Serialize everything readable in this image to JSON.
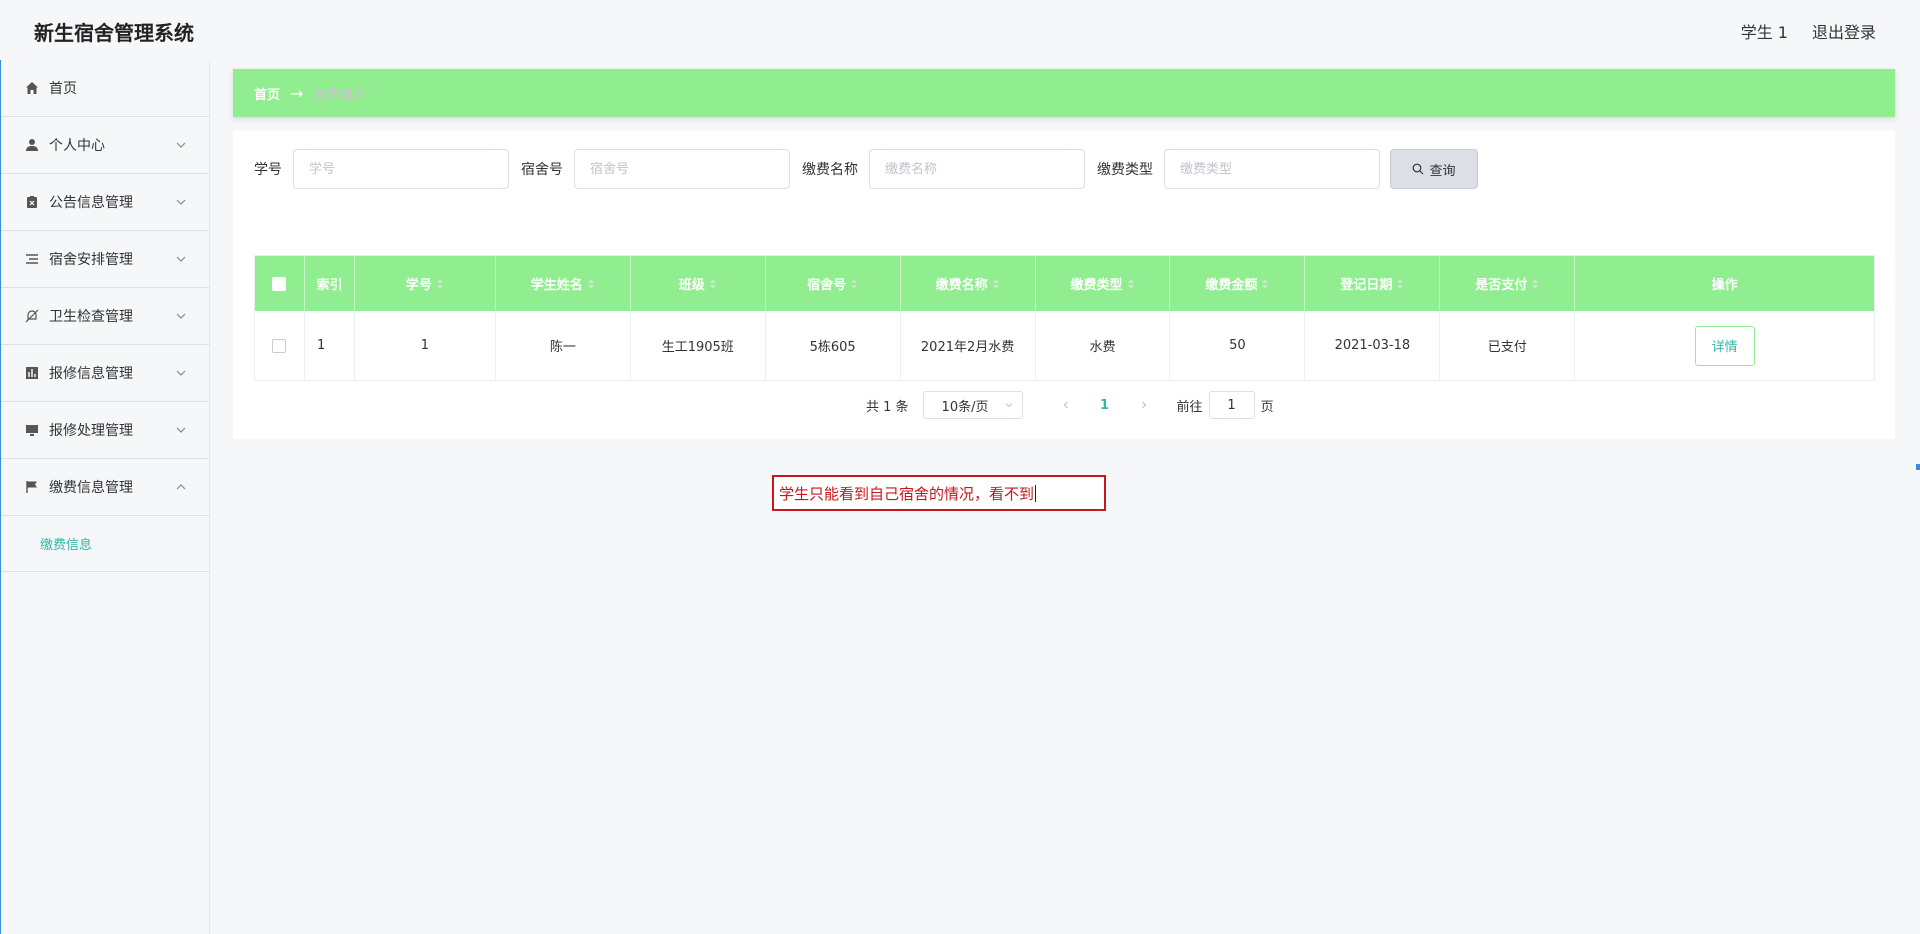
{
  "header": {
    "app_title": "新生宿舍管理系统",
    "user_label": "学生 1",
    "logout_label": "退出登录"
  },
  "sidebar": {
    "items": [
      {
        "label": "首页",
        "icon": "home-icon",
        "expandable": false
      },
      {
        "label": "个人中心",
        "icon": "user-icon",
        "expandable": true
      },
      {
        "label": "公告信息管理",
        "icon": "clipboard-icon",
        "expandable": true
      },
      {
        "label": "宿舍安排管理",
        "icon": "list-icon",
        "expandable": true
      },
      {
        "label": "卫生检查管理",
        "icon": "bell-off-icon",
        "expandable": true
      },
      {
        "label": "报修信息管理",
        "icon": "bar-chart-icon",
        "expandable": true
      },
      {
        "label": "报修处理管理",
        "icon": "monitor-icon",
        "expandable": true
      },
      {
        "label": "缴费信息管理",
        "icon": "flag-icon",
        "expandable": true,
        "expanded": true
      }
    ],
    "submenu": {
      "label": "缴费信息"
    }
  },
  "breadcrumb": {
    "home": "首页",
    "arrow": "→",
    "current": "缴费信息"
  },
  "search": {
    "student_no_label": "学号",
    "student_no_placeholder": "学号",
    "dorm_no_label": "宿舍号",
    "dorm_no_placeholder": "宿舍号",
    "fee_name_label": "缴费名称",
    "fee_name_placeholder": "缴费名称",
    "fee_type_label": "缴费类型",
    "fee_type_placeholder": "缴费类型",
    "query_button": "查询"
  },
  "table": {
    "headers": [
      "索引",
      "学号",
      "学生姓名",
      "班级",
      "宿舍号",
      "缴费名称",
      "缴费类型",
      "缴费金额",
      "登记日期",
      "是否支付",
      "操作"
    ],
    "rows": [
      {
        "index": "1",
        "student_no": "1",
        "student_name": "陈一",
        "class": "生工1905班",
        "dorm_no": "5栋605",
        "fee_name": "2021年2月水费",
        "fee_type": "水费",
        "fee_amount": "50",
        "register_date": "2021-03-18",
        "paid": "已支付",
        "action": "详情"
      }
    ]
  },
  "pagination": {
    "total_text": "共 1 条",
    "page_size": "10条/页",
    "current_page": "1",
    "goto_label": "前往",
    "goto_value": "1",
    "page_suffix": "页"
  },
  "note": {
    "text": "学生只能看到自己宿舍的情况，看不到"
  },
  "colors": {
    "accent_green": "#90ee90",
    "teal": "#33b7a7",
    "note_red": "#c8161d"
  }
}
